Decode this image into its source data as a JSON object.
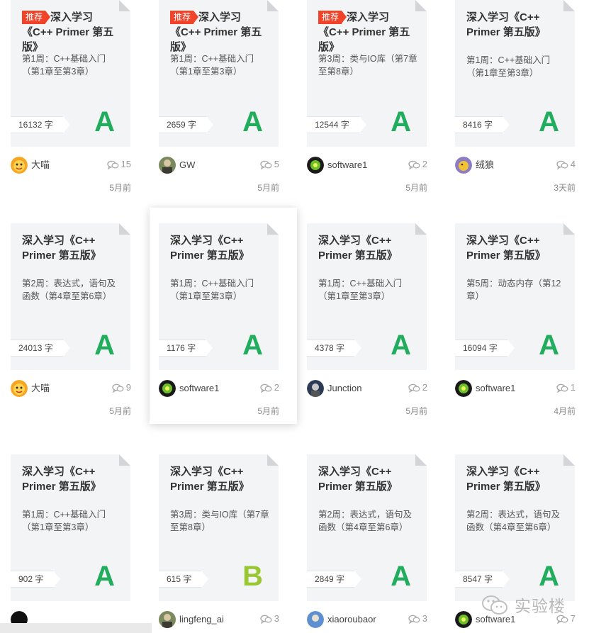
{
  "colors": {
    "grade_A": "#21ad5d",
    "grade_B": "#99c732",
    "badge": "#f0432a"
  },
  "count_unit": "字",
  "cards": [
    {
      "badge": "推荐",
      "title": "深入学习《C++ Primer 第五版》",
      "subtitle": "第1周：C++基础入门（第1章至第3章）",
      "count": "16132",
      "grade": "A",
      "grade_color": "#21ad5d",
      "user": "大喵",
      "avatar": "avatar-yellow",
      "comments": "15",
      "time": "5月前"
    },
    {
      "badge": "推荐",
      "title": "深入学习《C++ Primer 第五版》",
      "subtitle": "第1周：C++基础入门（第1章至第3章）",
      "count": "2659",
      "grade": "A",
      "grade_color": "#21ad5d",
      "user": "GW",
      "avatar": "avatar-photo",
      "comments": "5",
      "time": "5月前"
    },
    {
      "badge": "推荐",
      "title": "深入学习《C++ Primer 第五版》",
      "subtitle": "第3周：类与IO库（第7章至第8章）",
      "count": "12544",
      "grade": "A",
      "grade_color": "#21ad5d",
      "user": "software1",
      "avatar": "avatar-green",
      "comments": "2",
      "time": "5月前"
    },
    {
      "badge": "",
      "title": "深入学习《C++ Primer 第五版》",
      "subtitle": "第1周：C++基础入门（第1章至第3章）",
      "count": "8416",
      "grade": "A",
      "grade_color": "#21ad5d",
      "user": "绒狼",
      "avatar": "avatar-purple",
      "comments": "4",
      "time": "3天前"
    },
    {
      "badge": "",
      "title": "深入学习《C++ Primer 第五版》",
      "subtitle": "第2周：表达式，语句及函数（第4章至第6章）",
      "count": "24013",
      "grade": "A",
      "grade_color": "#21ad5d",
      "user": "大喵",
      "avatar": "avatar-yellow",
      "comments": "9",
      "time": "5月前"
    },
    {
      "badge": "",
      "title": "深入学习《C++ Primer 第五版》",
      "subtitle": "第1周：C++基础入门（第1章至第3章）",
      "count": "1176",
      "grade": "A",
      "grade_color": "#21ad5d",
      "user": "software1",
      "avatar": "avatar-green",
      "comments": "2",
      "time": "5月前"
    },
    {
      "badge": "",
      "title": "深入学习《C++ Primer 第五版》",
      "subtitle": "第1周：C++基础入门（第1章至第3章）",
      "count": "4378",
      "grade": "A",
      "grade_color": "#21ad5d",
      "user": "Junction",
      "avatar": "avatar-dark",
      "comments": "2",
      "time": "5月前"
    },
    {
      "badge": "",
      "title": "深入学习《C++ Primer 第五版》",
      "subtitle": "第5周：动态内存（第12章）",
      "count": "16094",
      "grade": "A",
      "grade_color": "#21ad5d",
      "user": "software1",
      "avatar": "avatar-green",
      "comments": "1",
      "time": "4月前"
    },
    {
      "badge": "",
      "title": "深入学习《C++ Primer 第五版》",
      "subtitle": "第1周：C++基础入门（第1章至第3章）",
      "count": "902",
      "grade": "A",
      "grade_color": "#21ad5d",
      "user": "",
      "avatar": "avatar-black",
      "comments": "",
      "time": ""
    },
    {
      "badge": "",
      "title": "深入学习《C++ Primer 第五版》",
      "subtitle": "第3周：类与IO库（第7章至第8章）",
      "count": "615",
      "grade": "B",
      "grade_color": "#99c732",
      "user": "lingfeng_ai",
      "avatar": "avatar-photo",
      "comments": "3",
      "time": ""
    },
    {
      "badge": "",
      "title": "深入学习《C++ Primer 第五版》",
      "subtitle": "第2周：表达式，语句及函数（第4章至第6章）",
      "count": "2849",
      "grade": "A",
      "grade_color": "#21ad5d",
      "user": "xiaoroubaor",
      "avatar": "avatar-sky",
      "comments": "3",
      "time": ""
    },
    {
      "badge": "",
      "title": "深入学习《C++ Primer 第五版》",
      "subtitle": "第2周：表达式，语句及函数（第4章至第6章）",
      "count": "8547",
      "grade": "A",
      "grade_color": "#21ad5d",
      "user": "software1",
      "avatar": "avatar-green",
      "comments": "7",
      "time": ""
    }
  ],
  "watermark": {
    "text": "实验楼",
    "icon": "wechat-icon"
  }
}
